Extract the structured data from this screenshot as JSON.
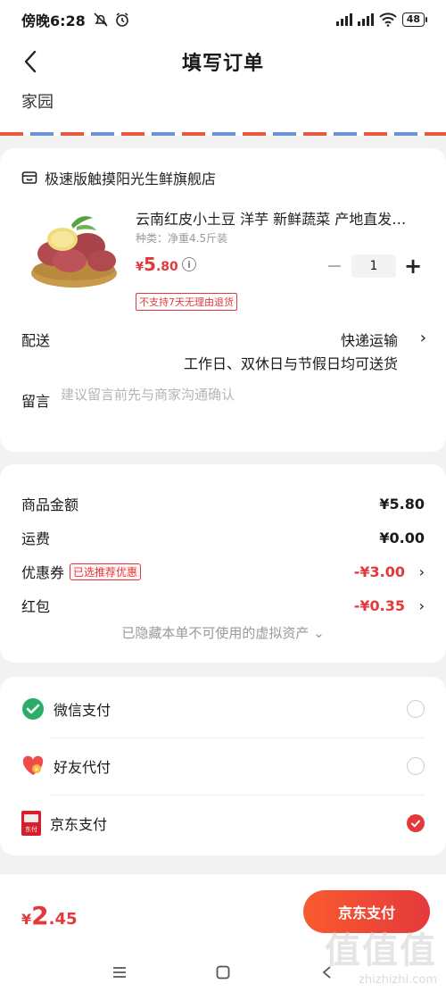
{
  "status_bar": {
    "time": "傍晚6:28",
    "battery": "48"
  },
  "header": {
    "title": "填写订单"
  },
  "address": {
    "text": "家园"
  },
  "shop": {
    "name": "极速版触摸阳光生鲜旗舰店"
  },
  "product": {
    "title": "云南红皮小土豆 洋芋 新鲜蔬菜 产地直发…",
    "spec": "种类：净重4.5斤装",
    "price_currency": "¥",
    "price_int": "5",
    "price_dec": ".80",
    "quantity": "1",
    "return_tag": "不支持7天无理由退货"
  },
  "delivery": {
    "label": "配送",
    "method": "快递运输",
    "time": "工作日、双休日与节假日均可送货"
  },
  "memo": {
    "label": "留言",
    "placeholder": "建议留言前先与商家沟通确认"
  },
  "costs": {
    "goods_label": "商品金额",
    "goods_value": "¥5.80",
    "shipping_label": "运费",
    "shipping_value": "¥0.00",
    "coupon_label": "优惠券",
    "coupon_tag": "已选推荐优惠",
    "coupon_value": "-¥3.00",
    "redpacket_label": "红包",
    "redpacket_value": "-¥0.35",
    "hidden_note": "已隐藏本单不可使用的虚拟资产 ⌄"
  },
  "payment": {
    "options": [
      {
        "label": "微信支付",
        "selected": false
      },
      {
        "label": "好友代付",
        "selected": false
      },
      {
        "label": "京东支付",
        "selected": true
      }
    ],
    "jd_icon_text": "东付"
  },
  "bottom": {
    "total_currency": "¥",
    "total_int": "2",
    "total_dec": ".45",
    "pay_button": "京东支付"
  },
  "watermark": {
    "logo": "值值值",
    "url": "zhizhizhi.com"
  },
  "colors": {
    "accent": "#e4393c",
    "wechat": "#2aae67"
  }
}
